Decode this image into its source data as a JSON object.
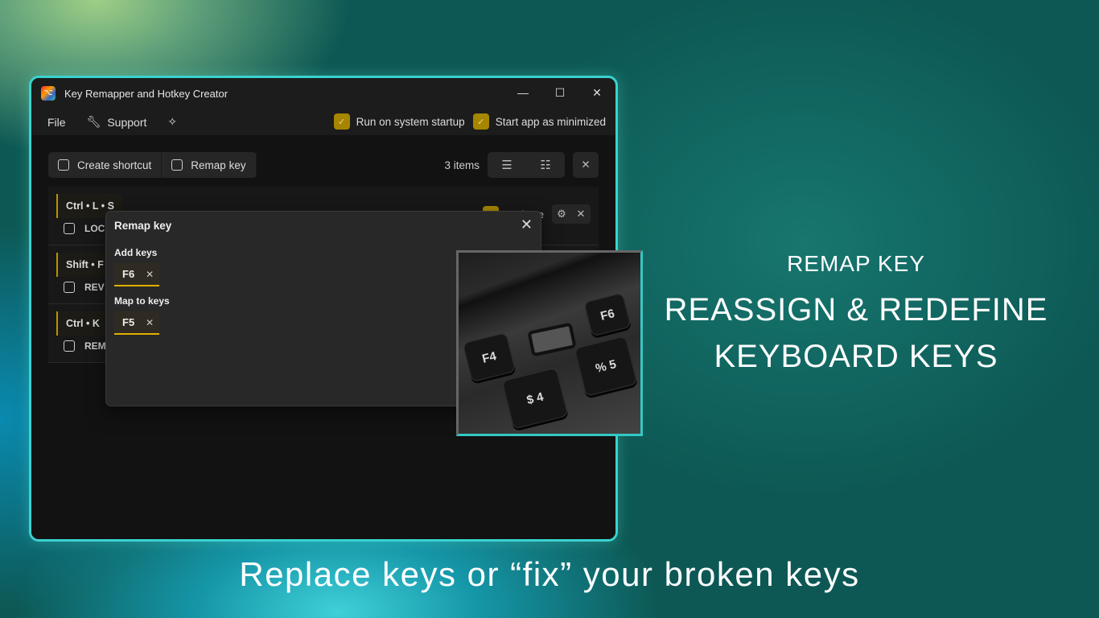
{
  "window": {
    "title": "Key Remapper and Hotkey Creator",
    "controls": [
      "minimize",
      "maximize",
      "close"
    ]
  },
  "menu": {
    "file": "File",
    "support": "Support"
  },
  "options": [
    {
      "label": "Run on system startup",
      "checked": true
    },
    {
      "label": "Start app as minimized",
      "checked": true
    }
  ],
  "toolbar": {
    "create_shortcut": "Create shortcut",
    "remap_key": "Remap key",
    "count": "3 items"
  },
  "rows": [
    {
      "keys": "Ctrl • L • S",
      "action": "LOC",
      "activate": "Activate"
    },
    {
      "keys": "Shift • F",
      "action": "REV"
    },
    {
      "keys": "Ctrl • K",
      "action": "REM"
    }
  ],
  "dialog": {
    "title": "Remap key",
    "add_label": "Add keys",
    "add_key": "F6",
    "map_label": "Map to keys",
    "map_key": "F5"
  },
  "photo": {
    "keys": [
      "F4",
      "F6",
      "$",
      "4",
      "%",
      "5"
    ]
  },
  "headline": {
    "small": "REMAP KEY",
    "line1": "REASSIGN & REDEFINE",
    "line2": "KEYBOARD KEYS"
  },
  "footer": "Replace keys or “fix” your broken keys",
  "colors": {
    "accent": "#b89400",
    "border": "#39d3cf"
  }
}
